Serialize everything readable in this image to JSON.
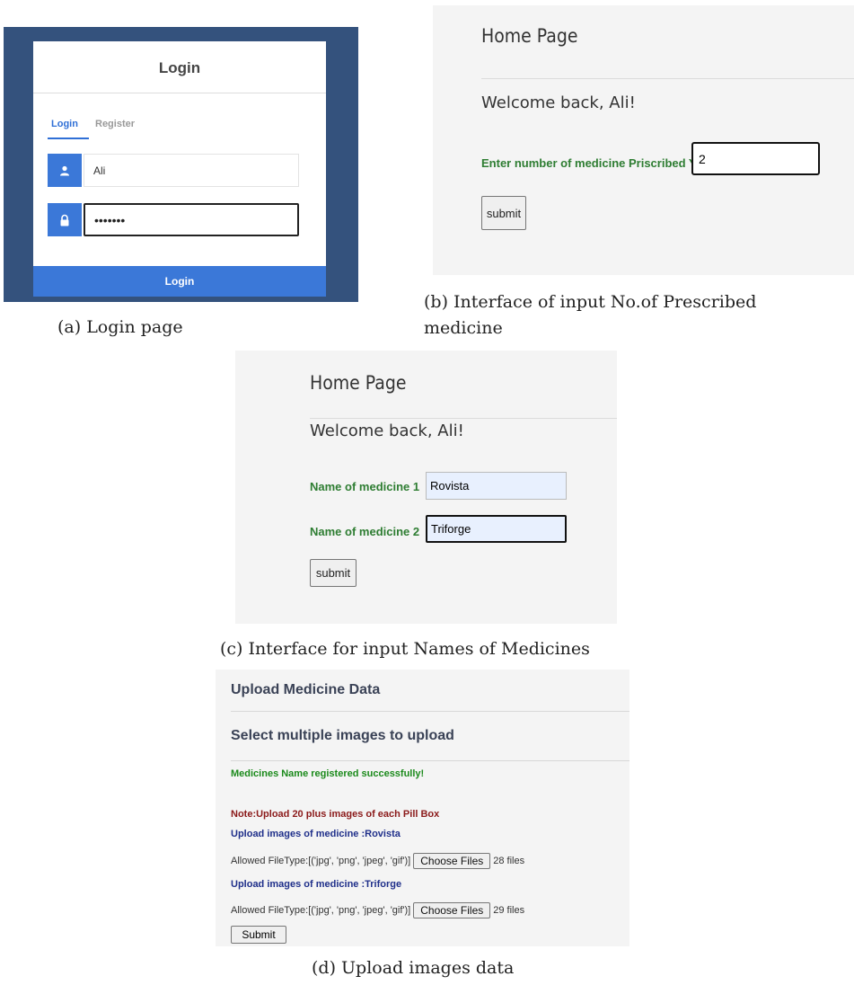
{
  "login_panel": {
    "title": "Login",
    "tabs": [
      "Login",
      "Register"
    ],
    "username_value": "Ali",
    "password_value": "•••••••",
    "login_button": "Login",
    "caption": "(a) Login page"
  },
  "prescribed_panel": {
    "home_title": "Home Page",
    "welcome": "Welcome back, Ali!",
    "label": "Enter number of medicine Priscribed You",
    "input_value": "2",
    "submit_label": "submit",
    "caption_line1": "(b) Interface of input No.of Prescribed",
    "caption_line2": "medicine"
  },
  "names_panel": {
    "home_title": "Home Page",
    "welcome": "Welcome back, Ali!",
    "medicines": [
      {
        "label": "Name of medicine 1",
        "value": "Rovista"
      },
      {
        "label": "Name of medicine 2",
        "value": "Triforge"
      }
    ],
    "submit_label": "submit",
    "caption": "(c) Interface for input Names of Medicines"
  },
  "upload_panel": {
    "title": "Upload Medicine Data",
    "subtitle": "Select multiple images to upload",
    "success_message": "Medicines Name registered successfully!",
    "note": "Note:Upload 20 plus images of each Pill Box",
    "medicines": [
      {
        "heading": "Upload images of medicine :Rovista",
        "allowed": "Allowed FileType:[('jpg', 'png', 'jpeg', 'gif')]",
        "button": "Choose Files",
        "count": "28 files"
      },
      {
        "heading": "Upload images of medicine :Triforge",
        "allowed": "Allowed FileType:[('jpg', 'png', 'jpeg', 'gif')]",
        "button": "Choose Files",
        "count": "29 files"
      }
    ],
    "submit_label": "Submit",
    "caption": "(d) Upload images data"
  },
  "colors": {
    "login_bg": "#34527d",
    "accent_blue": "#3b78d8",
    "green_label": "#2e7d32",
    "success_green": "#1b8a1b",
    "note_red": "#8b1a1a",
    "heading_navy": "#1f2f8a"
  }
}
